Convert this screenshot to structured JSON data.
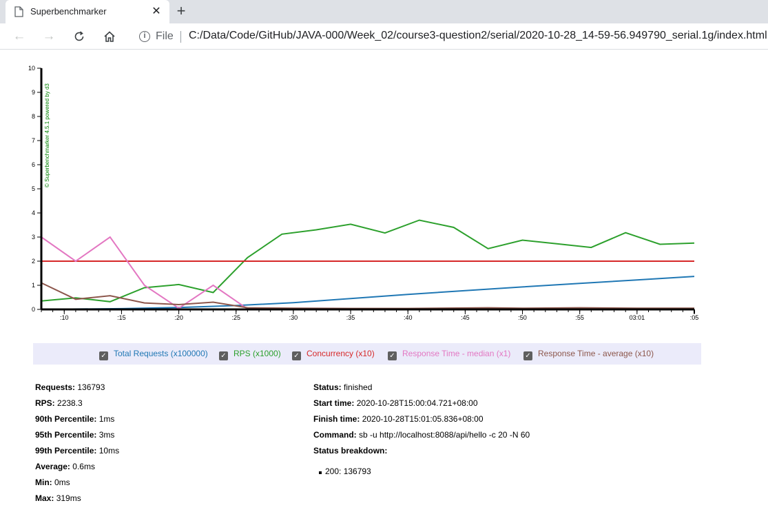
{
  "browser": {
    "tab_title": "Superbenchmarker",
    "new_tab": "+",
    "close": "✕",
    "file_label": "File",
    "url": "C:/Data/Code/GitHub/JAVA-000/Week_02/course3-question2/serial/2020-10-28_14-59-56.949790_serial.1g/index.html"
  },
  "chart_data": {
    "type": "line",
    "watermark": "© Superbenchmarker 4.5.1 powered by d3",
    "ylim": [
      0,
      10
    ],
    "y_ticks": [
      "0",
      "1",
      "2",
      "3",
      "4",
      "5",
      "6",
      "7",
      "8",
      "9",
      "10"
    ],
    "xlim": [
      8,
      65
    ],
    "x_ticks": [
      {
        "v": 10,
        "label": ":10"
      },
      {
        "v": 15,
        "label": ":15"
      },
      {
        "v": 20,
        "label": ":20"
      },
      {
        "v": 25,
        "label": ":25"
      },
      {
        "v": 30,
        "label": ":30"
      },
      {
        "v": 35,
        "label": ":35"
      },
      {
        "v": 40,
        "label": ":40"
      },
      {
        "v": 45,
        "label": ":45"
      },
      {
        "v": 50,
        "label": ":50"
      },
      {
        "v": 55,
        "label": ":55"
      },
      {
        "v": 60,
        "label": "03:01"
      },
      {
        "v": 65,
        "label": ":05"
      }
    ],
    "series": [
      {
        "name": "Total Requests (x100000)",
        "color": "#1f77b4",
        "x": [
          8,
          10,
          15,
          20,
          25,
          30,
          35,
          40,
          45,
          50,
          55,
          60,
          65
        ],
        "y": [
          0,
          0.01,
          0.03,
          0.08,
          0.16,
          0.28,
          0.45,
          0.62,
          0.78,
          0.93,
          1.08,
          1.22,
          1.37
        ]
      },
      {
        "name": "RPS (x1000)",
        "color": "#2ca02c",
        "x": [
          8,
          11,
          14,
          17,
          20,
          23,
          26,
          29,
          32,
          35,
          38,
          41,
          44,
          47,
          50,
          53,
          56,
          59,
          62,
          65
        ],
        "y": [
          0.35,
          0.48,
          0.32,
          0.9,
          1.03,
          0.7,
          2.15,
          3.12,
          3.3,
          3.53,
          3.17,
          3.7,
          3.4,
          2.52,
          2.87,
          2.72,
          2.57,
          3.18,
          2.7,
          2.75
        ]
      },
      {
        "name": "Concurrency (x10)",
        "color": "#d62728",
        "x": [
          8,
          65
        ],
        "y": [
          2,
          2
        ]
      },
      {
        "name": "Response Time - median (x1)",
        "color": "#e377c2",
        "x": [
          8,
          11,
          14,
          17,
          20,
          23,
          26
        ],
        "y": [
          3,
          2,
          3,
          1,
          0.05,
          1,
          0.02
        ]
      },
      {
        "name": "Response Time - average (x10)",
        "color": "#8c564b",
        "x": [
          8,
          11,
          14,
          17,
          20,
          23,
          26,
          30,
          35,
          40,
          47,
          50,
          55,
          60,
          65
        ],
        "y": [
          1.1,
          0.42,
          0.57,
          0.27,
          0.2,
          0.3,
          0.07,
          0.05,
          0.04,
          0.04,
          0.07,
          0.05,
          0.07,
          0.05,
          0.05
        ]
      }
    ]
  },
  "legend": [
    {
      "label": "Total Requests (x100000)",
      "color": "#1f77b4"
    },
    {
      "label": "RPS (x1000)",
      "color": "#2ca02c"
    },
    {
      "label": "Concurrency (x10)",
      "color": "#d62728"
    },
    {
      "label": "Response Time - median (x1)",
      "color": "#e377c2"
    },
    {
      "label": "Response Time - average (x10)",
      "color": "#8c564b"
    }
  ],
  "stats_left": [
    {
      "label": "Requests:",
      "value": "136793"
    },
    {
      "label": "RPS:",
      "value": "2238.3"
    },
    {
      "label": "90th Percentile:",
      "value": "1ms"
    },
    {
      "label": "95th Percentile:",
      "value": "3ms"
    },
    {
      "label": "99th Percentile:",
      "value": "10ms"
    },
    {
      "label": "Average:",
      "value": "0.6ms"
    },
    {
      "label": "Min:",
      "value": "0ms"
    },
    {
      "label": "Max:",
      "value": "319ms"
    }
  ],
  "stats_right": [
    {
      "label": "Status:",
      "value": "finished"
    },
    {
      "label": "Start time:",
      "value": "2020-10-28T15:00:04.721+08:00"
    },
    {
      "label": "Finish time:",
      "value": "2020-10-28T15:01:05.836+08:00"
    },
    {
      "label": "Command:",
      "value": "sb -u http://localhost:8088/api/hello -c 20 -N 60"
    },
    {
      "label": "Status breakdown:",
      "value": ""
    }
  ],
  "status_breakdown": [
    "200: 136793"
  ]
}
